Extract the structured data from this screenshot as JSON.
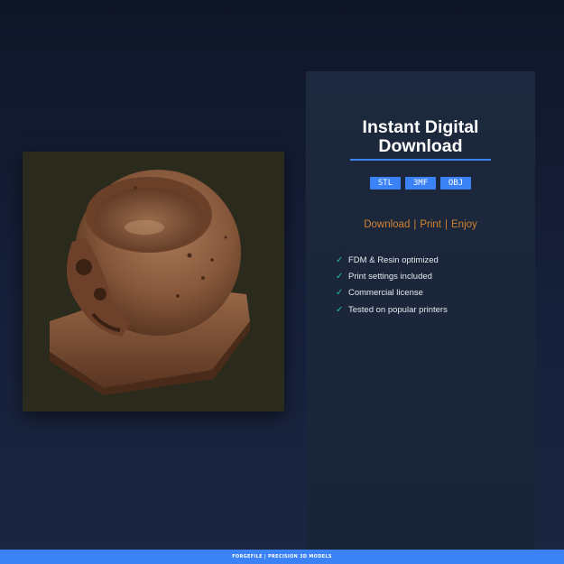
{
  "panel": {
    "title_line1": "Instant Digital",
    "title_line2": "Download",
    "formats": [
      "STL",
      "3MF",
      "OBJ"
    ],
    "tagline": {
      "download": "Download",
      "print": "Print",
      "enjoy": "Enjoy",
      "separator": "|"
    },
    "features": [
      "FDM & Resin optimized",
      "Print settings included",
      "Commercial license",
      "Tested on popular printers"
    ],
    "check_icon": "check-icon"
  },
  "footer": {
    "text": "FORGEFILE | PRECISION 3D MODELS"
  },
  "colors": {
    "accent": "#3b82f6",
    "tagline": "#d4832f",
    "check": "#22c1a8",
    "model": "#8a5a3c"
  }
}
